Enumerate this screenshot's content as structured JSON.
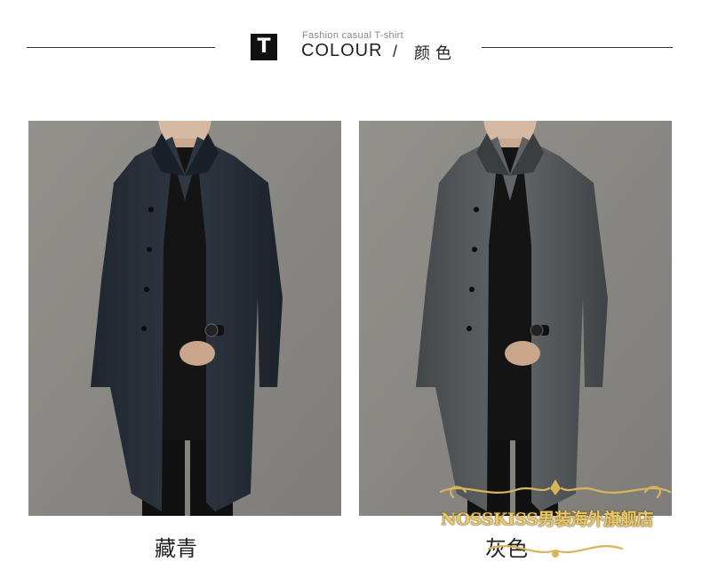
{
  "header": {
    "badge_letter": "T",
    "subtitle": "Fashion casual T-shirt",
    "title_en": "COLOUR",
    "separator": "/",
    "title_cn": "颜色"
  },
  "products": [
    {
      "caption": "藏青",
      "coat_color": "#2b333d",
      "icon": "navy-coat-photo"
    },
    {
      "caption": "灰色",
      "coat_color": "#55595c",
      "icon": "grey-coat-photo"
    }
  ],
  "watermark": {
    "text": "NOSSKISS男装海外旗舰店",
    "color": "#e7c86a"
  }
}
